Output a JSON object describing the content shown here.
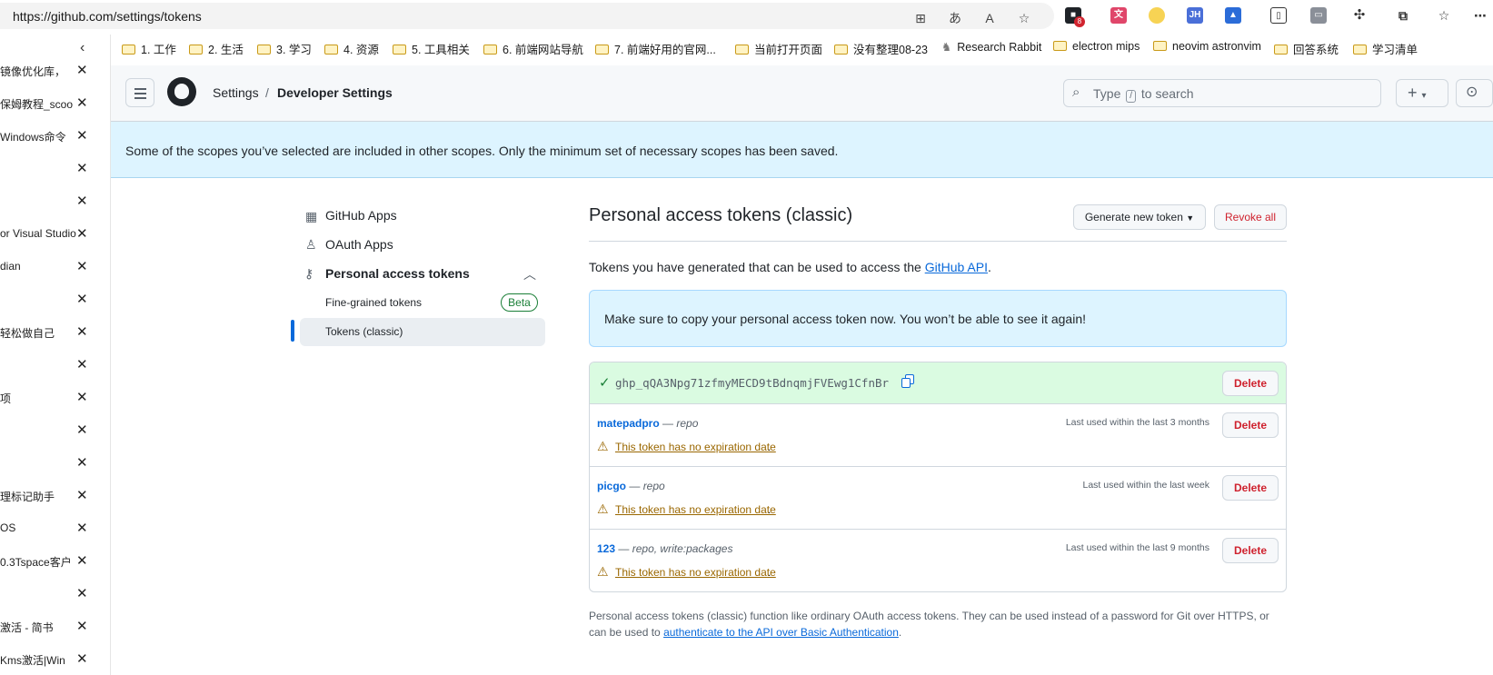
{
  "browser": {
    "url": "https://github.com/settings/tokens",
    "extension_badge": "8"
  },
  "bookmarks": [
    "1. 工作",
    "2. 生活",
    "3. 学习",
    "4. 资源",
    "5. 工具相关",
    "6. 前端网站导航",
    "7. 前端好用的官网...",
    "当前打开页面",
    "没有整理08-23",
    "Research Rabbit",
    "electron mips",
    "neovim astronvim",
    "回答系统",
    "学习清单"
  ],
  "vertical_tabs": [
    "镜像优化库，",
    "保姆教程_scoo",
    "Windows命令",
    "",
    "",
    "or Visual Studio",
    "dian",
    "",
    "轻松做自己",
    "",
    "项",
    "",
    "",
    "理标记助手",
    "OS",
    "0.3Tspace客户",
    "",
    "激活 - 简书",
    "Kms激活|Win"
  ],
  "header": {
    "crumb_settings": "Settings",
    "crumb_sep": "/",
    "crumb_developer": "Developer Settings",
    "search_before": "Type",
    "search_key": "/",
    "search_after": "to search"
  },
  "flash": "Some of the scopes you’ve selected are included in other scopes. Only the minimum set of necessary scopes has been saved.",
  "sidebar": {
    "github_apps": "GitHub Apps",
    "oauth_apps": "OAuth Apps",
    "pat": "Personal access tokens",
    "fine_grained": "Fine-grained tokens",
    "beta": "Beta",
    "classic": "Tokens (classic)"
  },
  "main": {
    "title": "Personal access tokens (classic)",
    "generate_label": "Generate new token",
    "revoke_label": "Revoke all",
    "intro_before": "Tokens you have generated that can be used to access the ",
    "intro_link": "GitHub API",
    "intro_after": ".",
    "notice": "Make sure to copy your personal access token now. You won’t be able to see it again!",
    "new_token": "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",
    "delete_label": "Delete",
    "warning": "This token has no expiration date",
    "footer_text": "Personal access tokens (classic) function like ordinary OAuth access tokens. They can be used instead of a password for Git over HTTPS, or can be used to ",
    "footer_link": "authenticate to the API over Basic Authentication",
    "footer_end": "."
  },
  "tokens": [
    {
      "name": "matepadpro",
      "dash": "—",
      "scopes": "repo",
      "last_used": "Last used within the last 3 months"
    },
    {
      "name": "picgo",
      "dash": "—",
      "scopes": "repo",
      "last_used": "Last used within the last week"
    },
    {
      "name": "123",
      "dash": "—",
      "scopes": "repo, write:packages",
      "last_used": "Last used within the last 9 months"
    }
  ],
  "colors": {
    "accent": "#0969da",
    "danger": "#cf222e",
    "success": "#1a7f37",
    "attention": "#9a6700",
    "flash_bg": "#ddf4ff"
  }
}
